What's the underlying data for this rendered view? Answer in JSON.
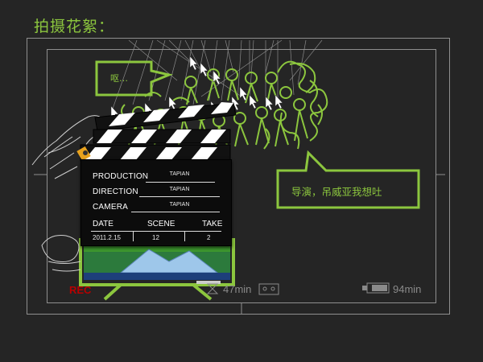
{
  "title": "拍摄花絮：",
  "bubble_small": "呕…",
  "bubble_big": "导演，吊威亚我想吐",
  "slate": {
    "production_label": "PRODUCTION",
    "production_value": "TAPIAN",
    "direction_label": "DIRECTION",
    "direction_value": "TAPIAN",
    "camera_label": "CAMERA",
    "camera_value": "TAPIAN",
    "date_label": "DATE",
    "scene_label": "SCENE",
    "take_label": "TAKE",
    "date_value": "2011.2.15",
    "scene_value": "12",
    "take_value": "2"
  },
  "rec_label": "REC",
  "recorded_time": "47min",
  "battery_time": "94min",
  "colors": {
    "accent": "#8cc63e",
    "frame": "#8f8f8f",
    "rec": "#b80000"
  }
}
